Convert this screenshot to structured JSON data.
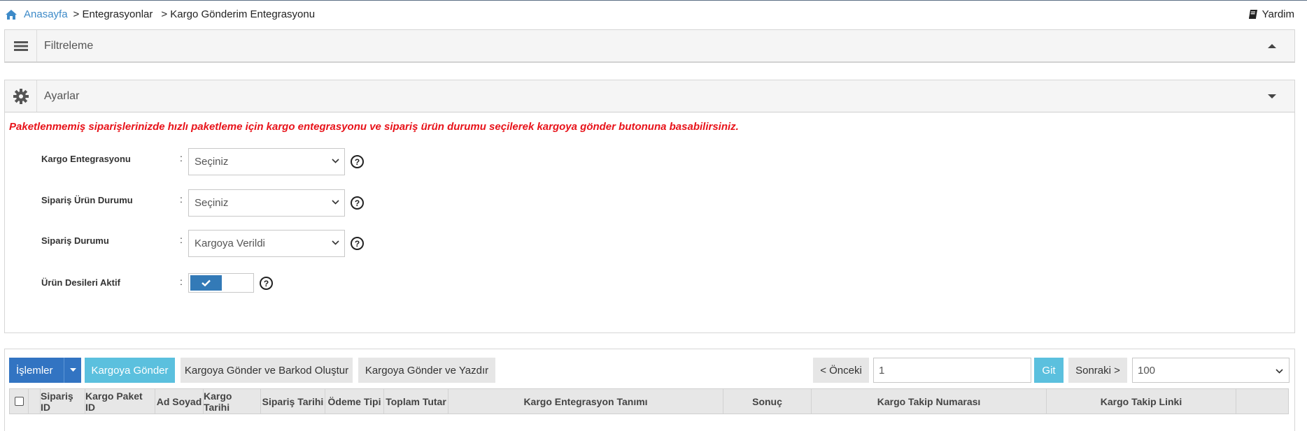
{
  "breadcrumb": {
    "home": "Anasayfa",
    "items": [
      "> Entegrasyonlar",
      "> Kargo Gönderim Entegrasyonu"
    ]
  },
  "help_label": "Yardim",
  "filter_panel": {
    "title": "Filtreleme",
    "state": "expanded"
  },
  "settings_panel": {
    "title": "Ayarlar",
    "notice": "Paketlenmemiş siparişlerinizde hızlı paketleme için kargo entegrasyonu ve sipariş ürün durumu seçilerek kargoya gönder butonuna basabilirsiniz.",
    "fields": {
      "cargo_integration": {
        "label": "Kargo Entegrasyonu",
        "value": "Seçiniz"
      },
      "product_status": {
        "label": "Sipariş Ürün Durumu",
        "value": "Seçiniz"
      },
      "order_status": {
        "label": "Sipariş Durumu",
        "value": "Kargoya Verildi"
      },
      "desi_active": {
        "label": "Ürün Desileri Aktif",
        "checked": true
      }
    },
    "colon": ":",
    "help_glyph": "?"
  },
  "toolbar": {
    "actions_label": "İşlemler",
    "send_label": "Kargoya Gönder",
    "send_barcode_label": "Kargoya Gönder ve Barkod Oluştur",
    "send_print_label": "Kargoya Gönder ve Yazdır",
    "prev_label": "< Önceki",
    "page_value": "1",
    "go_label": "Git",
    "next_label": "Sonraki >",
    "page_size": "100"
  },
  "table": {
    "columns": [
      "Sipariş ID",
      "Kargo Paket ID",
      "Ad Soyad",
      "Kargo Tarihi",
      "Sipariş Tarihi",
      "Ödeme Tipi",
      "Toplam Tutar",
      "Kargo Entegrasyon Tanımı",
      "Sonuç",
      "Kargo Takip Numarası",
      "Kargo Takip Linki"
    ]
  },
  "colors": {
    "link": "#3d8ac8",
    "notice": "#e8131a",
    "primary": "#3274c2",
    "info": "#5bc0de"
  },
  "icons": [
    "home-icon",
    "book-icon",
    "list-icon",
    "gear-icon",
    "caret-up-icon",
    "caret-down-icon",
    "chevron-down-icon",
    "question-icon",
    "check-icon"
  ]
}
